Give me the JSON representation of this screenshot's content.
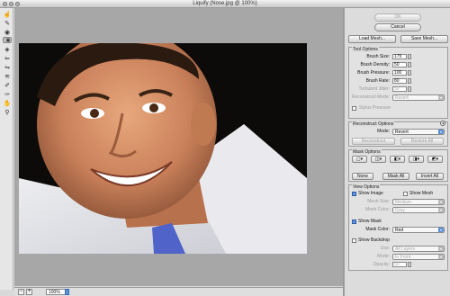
{
  "window": {
    "title": "Liquify (Nose.jpg @ 100%)"
  },
  "tools": [
    "forward-warp",
    "reconstruct",
    "twirl",
    "pucker",
    "bloat",
    "push-left",
    "mirror",
    "turbulence",
    "freeze-mask",
    "thaw-mask",
    "hand",
    "zoom"
  ],
  "buttons": {
    "ok": "OK",
    "cancel": "Cancel",
    "load_mesh": "Load Mesh...",
    "save_mesh": "Save Mesh..."
  },
  "tool_options": {
    "title": "Tool Options",
    "brush_size_label": "Brush Size:",
    "brush_size": "175",
    "brush_density_label": "Brush Density:",
    "brush_density": "50",
    "brush_pressure_label": "Brush Pressure:",
    "brush_pressure": "100",
    "brush_rate_label": "Brush Rate:",
    "brush_rate": "80",
    "turbulent_jitter_label": "Turbulent Jitter:",
    "turbulent_jitter": "50",
    "reconstruct_mode_label": "Reconstruct Mode:",
    "reconstruct_mode": "Revert",
    "stylus_pressure_label": "Stylus Pressure"
  },
  "reconstruct_options": {
    "title": "Reconstruct Options",
    "mode_label": "Mode:",
    "mode": "Revert",
    "reconstruct_btn": "Reconstruct",
    "restore_all_btn": "Restore All"
  },
  "mask_options": {
    "title": "Mask Options",
    "none_btn": "None",
    "mask_all_btn": "Mask All",
    "invert_all_btn": "Invert All"
  },
  "view_options": {
    "title": "View Options",
    "show_image": "Show Image",
    "show_mesh": "Show Mesh",
    "mesh_size_label": "Mesh Size:",
    "mesh_size": "Medium",
    "mesh_color_label": "Mesh Color:",
    "mesh_color": "Gray",
    "show_mask": "Show Mask",
    "mask_color_label": "Mask Color:",
    "mask_color": "Red",
    "show_backdrop": "Show Backdrop",
    "use_label": "Use:",
    "use": "All Layers",
    "mode_label": "Mode:",
    "mode": "In Front",
    "opacity_label": "Opacity:",
    "opacity": "50"
  },
  "status": {
    "zoom": "100%"
  },
  "colors": {
    "canvas": "#a7a7a7",
    "panel": "#dcdcdc",
    "accent": "#4b7fd1"
  }
}
